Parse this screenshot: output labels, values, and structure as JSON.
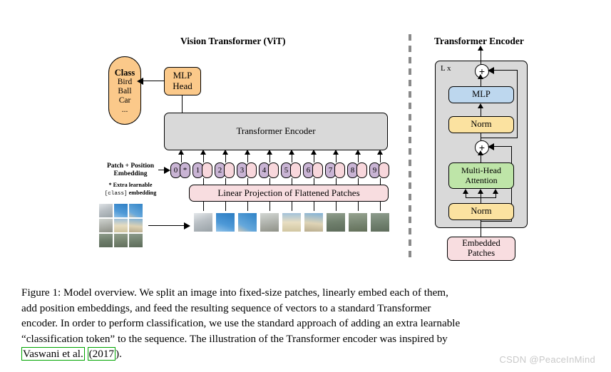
{
  "figure": {
    "left_title": "Vision Transformer (ViT)",
    "right_title": "Transformer Encoder"
  },
  "class_head": {
    "heading": "Class",
    "items": [
      "Bird",
      "Ball",
      "Car",
      "..."
    ],
    "mlp_head_line1": "MLP",
    "mlp_head_line2": "Head"
  },
  "encoder_bar": {
    "label": "Transformer Encoder"
  },
  "embedding": {
    "patch_pos_line1": "Patch + Position",
    "patch_pos_line2": "Embedding",
    "extra_line1": "* Extra learnable",
    "extra_class_token": "[class]",
    "extra_line2_tail": " embedding",
    "linear_projection": "Linear Projection of Flattened Patches",
    "class_token_symbol": "*",
    "token_numbers": [
      "0",
      "1",
      "2",
      "3",
      "4",
      "5",
      "6",
      "7",
      "8",
      "9"
    ]
  },
  "transformer_encoder": {
    "repeat_label": "L x",
    "mlp": "MLP",
    "norm_top": "Norm",
    "attention_line1": "Multi-Head",
    "attention_line2": "Attention",
    "norm_bottom": "Norm",
    "embedded_patches_line1": "Embedded",
    "embedded_patches_line2": "Patches",
    "residual_symbol": "+"
  },
  "caption": {
    "line1": "Figure 1: Model overview. We split an image into fixed-size patches, linearly embed each of them,",
    "line2": "add position embeddings, and feed the resulting sequence of vectors to a standard Transformer",
    "line3": "encoder. In order to perform classification, we use the standard approach of adding an extra learnable",
    "line4": "“classification token” to the sequence. The illustration of the Transformer encoder was inspired by",
    "cite_author": "Vaswani et al.",
    "cite_year_open": "(2017",
    "cite_tail": ")."
  },
  "watermark": {
    "text": "CSDN @PeaceInMind"
  },
  "colors": {
    "class_orange": "#fbc98a",
    "encoder_gray": "#d9d9d9",
    "token_purple": "#c9b4d4",
    "token_pink": "#f8d7dc",
    "linproj_pink": "#f8dde0",
    "mlp_blue": "#bdd7ee",
    "norm_yellow": "#fbe2a0",
    "attention_green": "#bee5a8",
    "citation_green": "#00a500",
    "watermark_gray": "#c9c9c9"
  }
}
